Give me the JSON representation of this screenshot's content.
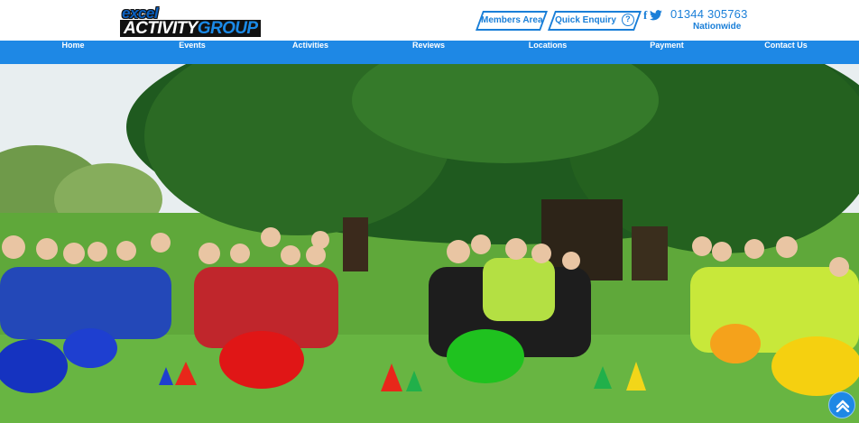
{
  "logo": {
    "line1": "excel",
    "line2_a": "ACTIVITY",
    "line2_b": "GROUP"
  },
  "header": {
    "members_area": "Members Area",
    "quick_enquiry": "Quick Enquiry",
    "help_symbol": "?",
    "phone": "01344 305763",
    "coverage": "Nationwide",
    "facebook_glyph": "f",
    "social_icons": [
      "facebook-icon",
      "twitter-icon"
    ]
  },
  "nav": {
    "items": [
      {
        "label": "Home"
      },
      {
        "label": "Events"
      },
      {
        "label": "Activities"
      },
      {
        "label": "Reviews"
      },
      {
        "label": "Locations"
      },
      {
        "label": "Payment"
      },
      {
        "label": "Contact Us"
      }
    ]
  },
  "hero": {
    "description_icon": "photo",
    "scroll_top_icon": "chevron-up-icon"
  },
  "colors": {
    "brand_blue": "#1e88e5",
    "nav_text": "#ffffff",
    "accent_blue": "#1a7fd8"
  }
}
